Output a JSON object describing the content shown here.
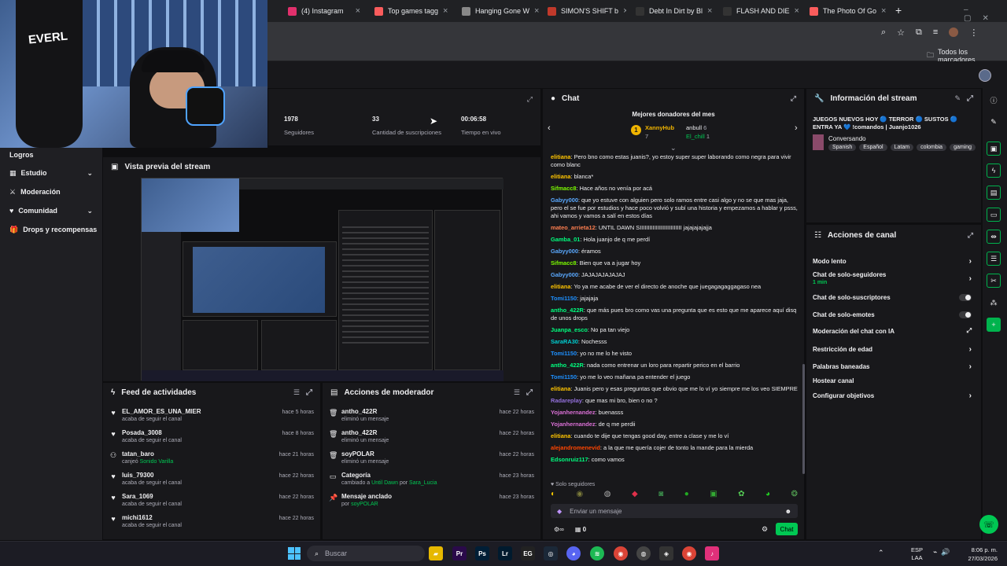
{
  "browser": {
    "tabs": [
      {
        "label": "(4) Instagram",
        "color": "#e1306c"
      },
      {
        "label": "Top games tagg",
        "color": "#fa5c5c"
      },
      {
        "label": "Hanging Gone W",
        "color": "#888888"
      },
      {
        "label": "SIMON'S SHIFT b",
        "color": "#c0392b"
      },
      {
        "label": "Debt In Dirt by Bl",
        "color": "#333333"
      },
      {
        "label": "FLASH AND DIE",
        "color": "#333333"
      },
      {
        "label": "The Photo Of Go",
        "color": "#fa5c5c"
      }
    ],
    "bookmarks_label": "Todos los marcadores"
  },
  "sidebar": {
    "items": [
      {
        "label": "Logros",
        "chev": false
      },
      {
        "label": "Estudio",
        "chev": true
      },
      {
        "label": "Moderación",
        "chev": false
      },
      {
        "label": "Comunidad",
        "chev": true
      },
      {
        "label": "Drops y recompensas",
        "chev": false
      }
    ]
  },
  "stats": [
    {
      "value": "1978",
      "label": "Seguidores"
    },
    {
      "value": "33",
      "label": "Cantidad de suscripciones"
    },
    {
      "value": "00:06:58",
      "label": "Tiempo en vivo"
    }
  ],
  "preview": {
    "title": "Vista previa del stream"
  },
  "feed": {
    "title": "Feed de actividades",
    "items": [
      {
        "name": "EL_AMOR_ES_UNA_MIER",
        "sub": "acaba de seguir el canal",
        "time": "hace 5 horas",
        "icon": "heart"
      },
      {
        "name": "Posada_3008",
        "sub": "acaba de seguir el canal",
        "time": "hace 8 horas",
        "icon": "heart"
      },
      {
        "name": "tatan_baro",
        "sub": "canjeó",
        "sub2": "Sonido Varilla",
        "time": "hace 21 horas",
        "icon": "points"
      },
      {
        "name": "luis_79300",
        "sub": "acaba de seguir el canal",
        "time": "hace 22 horas",
        "icon": "heart"
      },
      {
        "name": "Sara_1069",
        "sub": "acaba de seguir el canal",
        "time": "hace 22 horas",
        "icon": "heart"
      },
      {
        "name": "michi1612",
        "sub": "acaba de seguir el canal",
        "time": "hace 22 horas",
        "icon": "heart"
      }
    ]
  },
  "modactions": {
    "title": "Acciones de moderador",
    "items": [
      {
        "name": "antho_422R",
        "sub": "eliminó un mensaje",
        "time": "hace 22 horas",
        "icon": "trash"
      },
      {
        "name": "antho_422R",
        "sub": "eliminó un mensaje",
        "time": "hace 22 horas",
        "icon": "trash"
      },
      {
        "name": "soyPOLAR",
        "sub": "eliminó un mensaje",
        "time": "hace 22 horas",
        "icon": "trash"
      },
      {
        "name": "Categoría",
        "sub": "cambiado a",
        "sub2": "Until Dawn",
        "sub3": "por",
        "sub4": "Sara_Lucia",
        "time": "hace 23 horas",
        "icon": "category"
      },
      {
        "name": "Mensaje anclado",
        "sub": "por",
        "sub2": "soyPOLAR",
        "time": "hace 23 horas",
        "icon": "pin"
      }
    ]
  },
  "chat": {
    "title": "Chat",
    "donors_title": "Mejores donadores del mes",
    "donors": [
      {
        "name": "XannyHub",
        "count": "7"
      },
      {
        "name": "anbull",
        "count": "6"
      },
      {
        "name": "El_chill",
        "count": "1"
      }
    ],
    "messages": [
      {
        "user": "elitiana",
        "color": "#ffc400",
        "text": "Pero bno como estas juanis?, yo estoy super super laborando como negra para vivir como blanc"
      },
      {
        "user": "elitiana",
        "color": "#ffc400",
        "text": "blanca*"
      },
      {
        "user": "Sifmacc8",
        "color": "#7cfc00",
        "text": "Hace años no venía por acá"
      },
      {
        "user": "Gabyy000",
        "color": "#5aa9ff",
        "text": "que yo estuve con alguien pero solo ramos entre casi algo y no se que mas jaja, pero el se fue por estudios y hace poco volvió y subí una historia y empezamos a hablar y psss, ahi vamos y vamos a salí en estos días"
      },
      {
        "user": "mateo_arrieta12",
        "color": "#ff7f50",
        "text": "UNTIL DAWN SIIIIIIIIIIIIIIIIIIIIIIIIII jajajajajajja"
      },
      {
        "user": "Gamba_01",
        "color": "#00ff7f",
        "text": "Hola juanjo de q me perdí"
      },
      {
        "user": "Gabyy000",
        "color": "#5aa9ff",
        "text": "éramos"
      },
      {
        "user": "Sifmacc8",
        "color": "#7cfc00",
        "text": "Bien que va a jugar hoy"
      },
      {
        "user": "Gabyy000",
        "color": "#5aa9ff",
        "text": "JAJAJAJAJAJAJ"
      },
      {
        "user": "elitiana",
        "color": "#ffc400",
        "text": "Yo ya me acabe de ver el directo de anoche que juegagagaggagaso nea"
      },
      {
        "user": "Tomi1150",
        "color": "#1e90ff",
        "text": "jajajaja"
      },
      {
        "user": "antho_422R",
        "color": "#00ff7f",
        "text": "que más pues bro como vas una pregunta que es esto que me aparece aquí disq de unos drops"
      },
      {
        "user": "Juanpa_esco",
        "color": "#00ff7f",
        "text": "No pa tan viejo"
      },
      {
        "user": "SaraRA30",
        "color": "#00ced1",
        "text": "Nochesss"
      },
      {
        "user": "Tomi1150",
        "color": "#1e90ff",
        "text": "yo no me lo he visto"
      },
      {
        "user": "antho_422R",
        "color": "#00ff7f",
        "text": "nada como entrenar un loro para repartir perico en el barrio"
      },
      {
        "user": "Tomi1150",
        "color": "#1e90ff",
        "text": "yo me lo veo mañana pa entender el juego"
      },
      {
        "user": "elitiana",
        "color": "#ffc400",
        "text": "Juanis pero y esas preguntas que obvio que me lo ví yo siempre me los veo SIEMPRE"
      },
      {
        "user": "Radareplay",
        "color": "#9370db",
        "text": "que mas mi bro, bien o no ?"
      },
      {
        "user": "Yojanhernandez",
        "color": "#da70d6",
        "text": "buenasss"
      },
      {
        "user": "Yojanhernandez",
        "color": "#da70d6",
        "text": "de q me perdii"
      },
      {
        "user": "elitiana",
        "color": "#ffc400",
        "text": "cuando te dije que tengas good day, entre a clase y me lo ví"
      },
      {
        "user": "alejandromenevid",
        "color": "#ff4500",
        "text": "a la que me quería cojer de tonto la mande para la mierda"
      },
      {
        "user": "Edsonruiz117",
        "color": "#00ff7f",
        "text": "como vamos"
      }
    ],
    "followers_only": "Solo seguidores",
    "input_placeholder": "Enviar un mensaje",
    "points": "0",
    "send_label": "Chat"
  },
  "stream_info": {
    "title": "Información del stream",
    "stream_title": "JUEGOS NUEVOS HOY 🔵 TERROR 🔵 SUSTOS 🔵 ENTRA YA 💙 !comandos | Juanjo1026",
    "category": "Conversando",
    "tags": [
      "Spanish",
      "Español",
      "Latam",
      "colombia",
      "gaming"
    ]
  },
  "channel_actions": {
    "title": "Acciones de canal",
    "items": [
      {
        "label": "Modo lento",
        "control": "chevron"
      },
      {
        "label": "Chat de solo-seguidores",
        "sub": "1 min",
        "control": "chevron"
      },
      {
        "label": "Chat de solo-suscriptores",
        "control": "toggle"
      },
      {
        "label": "Chat de solo-emotes",
        "control": "toggle"
      },
      {
        "label": "Moderación del chat con IA",
        "control": "external"
      },
      {
        "label": "Restricción de edad",
        "control": "chevron"
      },
      {
        "label": "Palabras baneadas",
        "control": "chevron"
      },
      {
        "label": "Hostear canal",
        "control": "none"
      },
      {
        "label": "Configurar objetivos",
        "control": "chevron"
      }
    ]
  },
  "taskbar": {
    "search_placeholder": "Buscar",
    "lang": "ESP",
    "lang2": "LAA",
    "time": "8:06 p. m.",
    "date": "27/03/2026",
    "apps": [
      {
        "label": "Pr",
        "color": "#2a0a4a"
      },
      {
        "label": "Ps",
        "color": "#001e36"
      },
      {
        "label": "Lr",
        "color": "#001a2e"
      }
    ]
  }
}
